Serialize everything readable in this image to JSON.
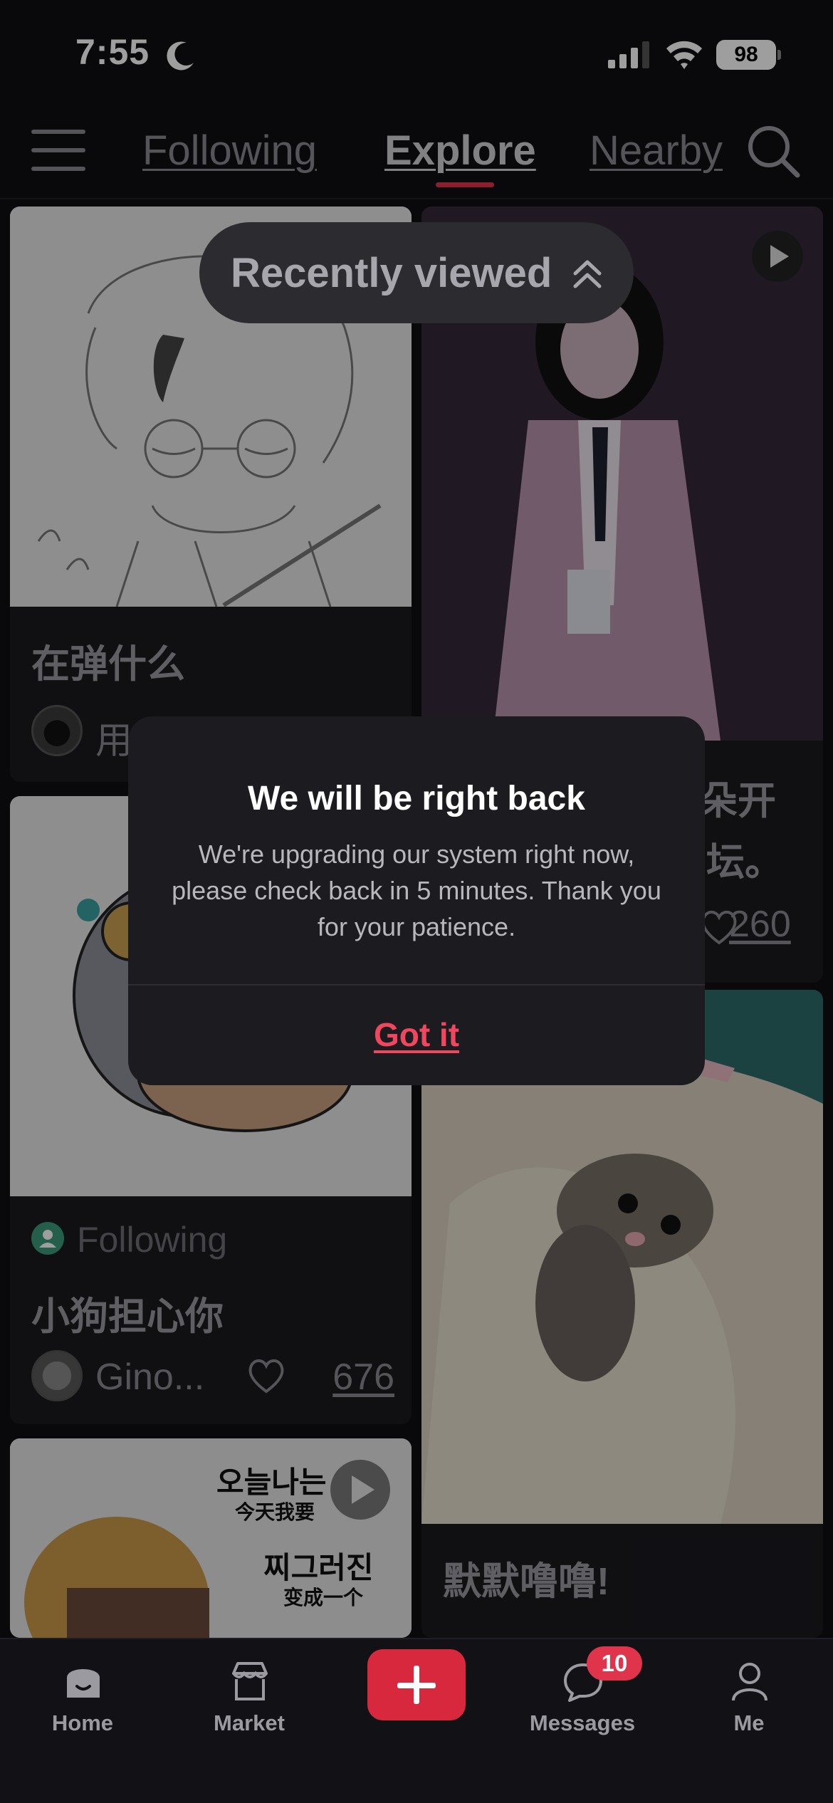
{
  "status_bar": {
    "time": "7:55",
    "battery": "98"
  },
  "top_nav": {
    "tabs": [
      "Following",
      "Explore",
      "Nearby"
    ],
    "active_tab": "Explore"
  },
  "recently_viewed": {
    "label": "Recently viewed"
  },
  "feed": {
    "left": [
      {
        "title": "在弹什么",
        "author": "用",
        "likes": ""
      },
      {
        "tag": "Following",
        "title": "小狗担心你",
        "author": "Gino...",
        "likes": "676"
      },
      {
        "image_text": [
          "오늘나는",
          "今天我要",
          "찌그러진",
          "变成一个"
        ]
      }
    ],
    "right": [
      {
        "title_fragment_1": "朵开",
        "title_fragment_2": "坛。",
        "likes": "260"
      },
      {
        "title": "默默噜噜!"
      }
    ]
  },
  "dialog": {
    "title": "We will be right back",
    "body": "We're upgrading our system right now, please check back in 5 minutes. Thank you for your patience.",
    "button": "Got it"
  },
  "bottom_nav": {
    "items": [
      "Home",
      "Market",
      "Messages",
      "Me"
    ],
    "messages_badge": "10"
  },
  "colors": {
    "accent": "#e0334c",
    "background": "#0f0f14",
    "dialog": "#1c1c20"
  }
}
